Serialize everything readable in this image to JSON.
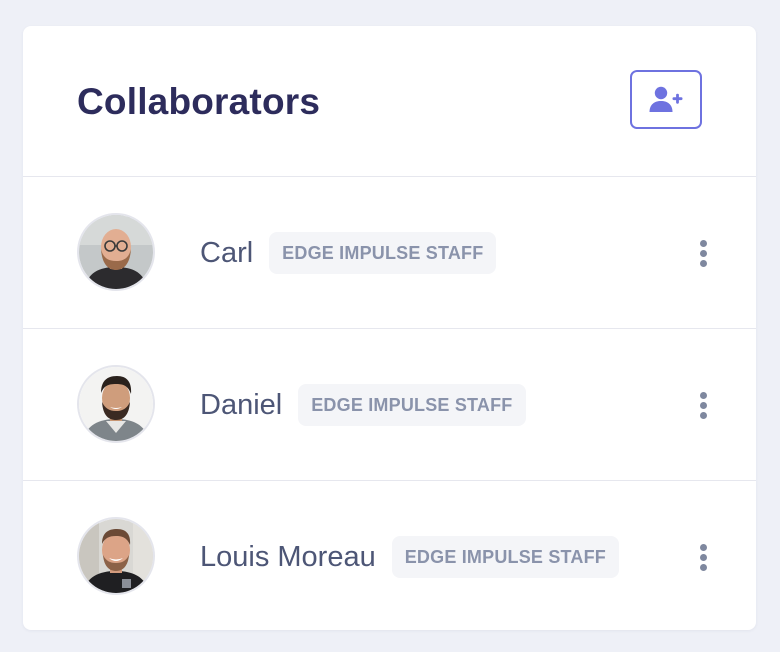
{
  "card": {
    "title": "Collaborators"
  },
  "header": {
    "add_button_icon": "add-user-icon",
    "accent_color": "#6e72e0"
  },
  "collaborators": [
    {
      "name": "Carl",
      "badge": "EDGE IMPULSE STAFF",
      "avatar_icon": "avatar-photo",
      "menu_icon": "more-vertical-icon"
    },
    {
      "name": "Daniel",
      "badge": "EDGE IMPULSE STAFF",
      "avatar_icon": "avatar-photo",
      "menu_icon": "more-vertical-icon"
    },
    {
      "name": "Louis Moreau",
      "badge": "EDGE IMPULSE STAFF",
      "avatar_icon": "avatar-photo",
      "menu_icon": "more-vertical-icon"
    }
  ]
}
